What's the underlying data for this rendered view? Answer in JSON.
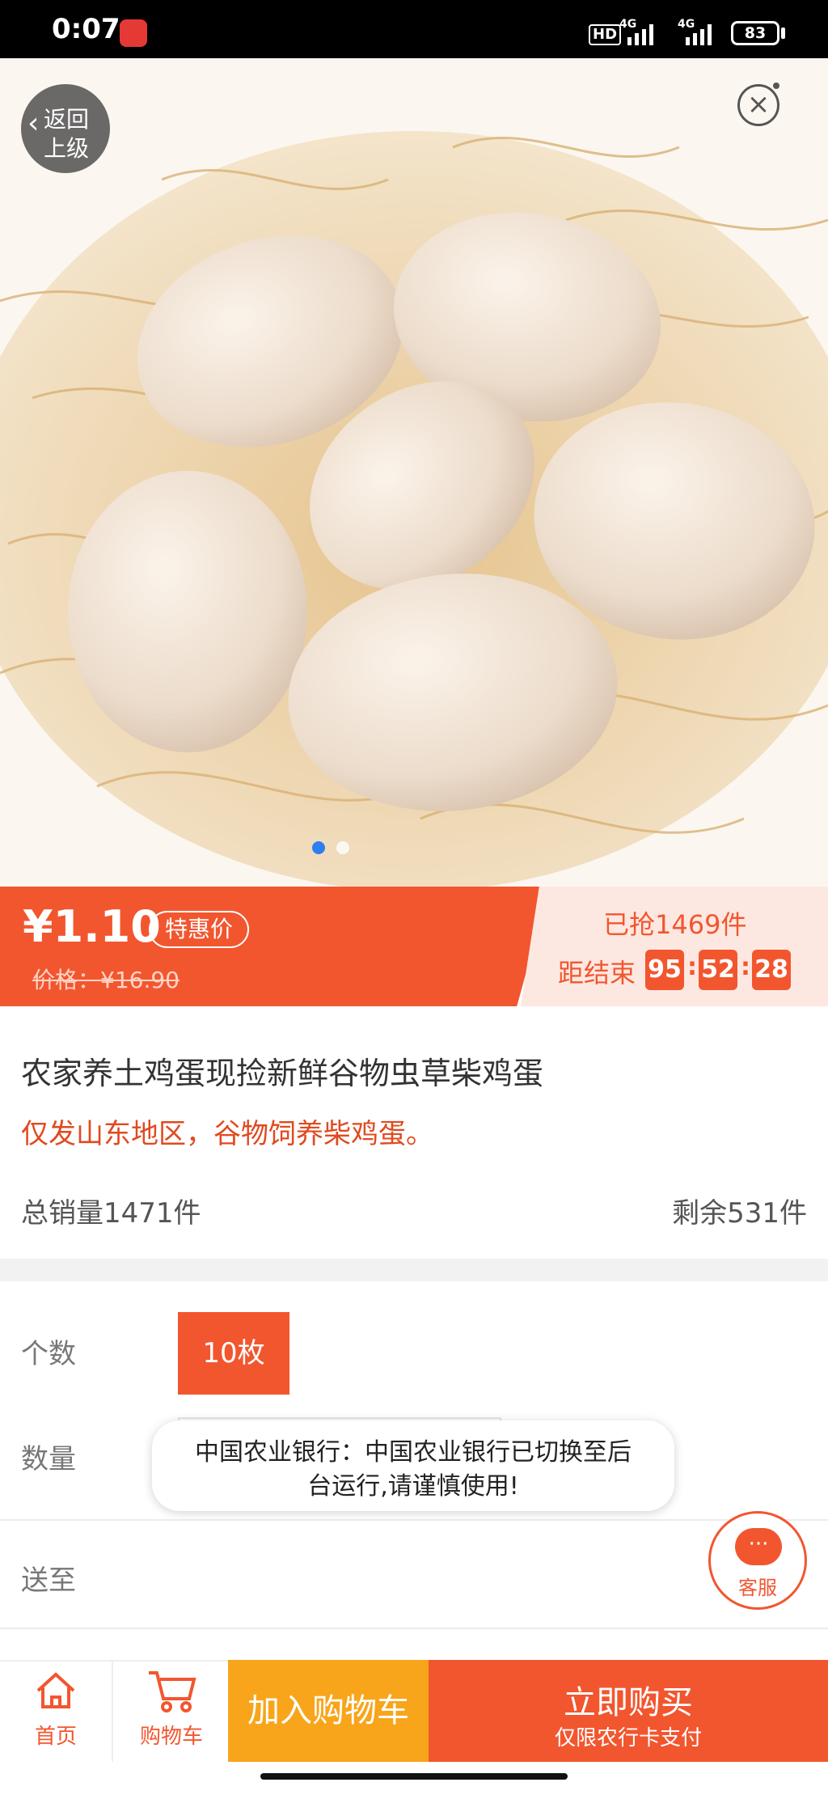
{
  "status": {
    "time": "0:07",
    "hd": "HD",
    "net1": "4G",
    "net2": "4G",
    "battery": "83"
  },
  "hero": {
    "back_line1": "返回",
    "back_line2": "上级",
    "close_icon": "×"
  },
  "price": {
    "current": "¥1.10",
    "tag": "特惠价",
    "original": "价格：¥16.90",
    "sold": "已抢1469件",
    "countdown_label": "距结束",
    "countdown": [
      "95",
      "52",
      "28"
    ]
  },
  "product": {
    "title": "农家养土鸡蛋现捡新鲜谷物虫草柴鸡蛋",
    "subtitle": "仅发山东地区，谷物饲养柴鸡蛋。",
    "sales_total": "总销量1471件",
    "stock_remaining": "剩余531件"
  },
  "options": {
    "count_label": "个数",
    "count_value": "10枚",
    "qty_label": "数量",
    "ship_label": "送至"
  },
  "toast": {
    "line1": "中国农业银行：中国农业银行已切换至后",
    "line2": "台运行,请谨慎使用!"
  },
  "service": {
    "label": "客服"
  },
  "nav": {
    "home": "首页",
    "cart": "购物车",
    "add_cart": "加入购物车",
    "buy_now": "立即购买",
    "buy_now_sub": "仅限农行卡支付"
  },
  "colors": {
    "accent": "#f2562f",
    "cart_button": "#f8a51b"
  }
}
